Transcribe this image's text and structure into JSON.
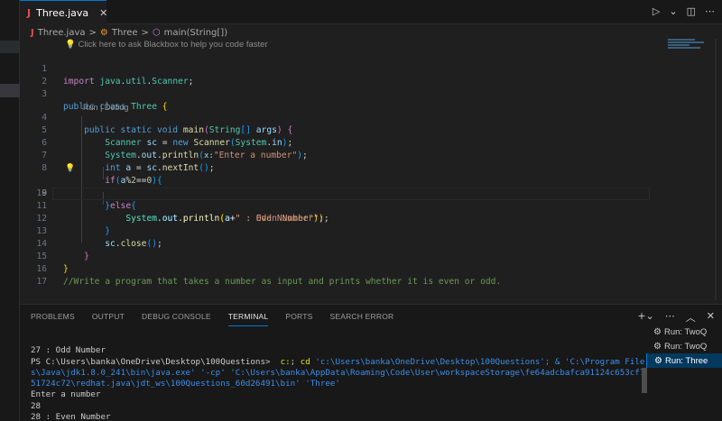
{
  "tab": {
    "title": "Three.java",
    "icon": "java-file-icon"
  },
  "breadcrumb": {
    "file": "Three.java",
    "cls": "Three",
    "method": "main(String[])",
    "sep": ">"
  },
  "editor": {
    "hint": "💡 Click here to ask Blackbox to help you code faster",
    "codelens": "Run | Debug",
    "line_numbers": [
      "1",
      "2",
      "3",
      "4",
      "5",
      "6",
      "7",
      "8",
      "9",
      "10",
      "11",
      "12",
      "13",
      "14",
      "15",
      "16",
      "17"
    ],
    "current_line": "9"
  },
  "panel": {
    "tabs": [
      "PROBLEMS",
      "OUTPUT",
      "DEBUG CONSOLE",
      "TERMINAL",
      "PORTS",
      "SEARCH ERROR"
    ],
    "active_tab": "TERMINAL",
    "terminal": {
      "l1": "27 : Odd Number",
      "l2a": "PS C:\\Users\\banka\\OneDrive\\Desktop\\100Questions>  ",
      "l2b": "c:",
      "l2c": "; ",
      "l2d": "cd",
      "l2e": " 'c:\\Users\\banka\\OneDrive\\Desktop\\100Questions'; & 'C:\\Program File",
      "l3": "s\\Java\\jdk1.8.0_241\\bin\\java.exe' '-cp' 'C:\\Users\\banka\\AppData\\Roaming\\Code\\User\\workspaceStorage\\fe64adcbafca91124c653cf7",
      "l4": "51724c72\\redhat.java\\jdt_ws\\100Questions_60d26491\\bin' 'Three'",
      "l5": "Enter a number",
      "l6": "28",
      "l7": "28 : Even Number"
    },
    "runs": [
      "Run: TwoQ",
      "Run: TwoQ",
      "Run: Three"
    ],
    "selected_run": 2
  }
}
